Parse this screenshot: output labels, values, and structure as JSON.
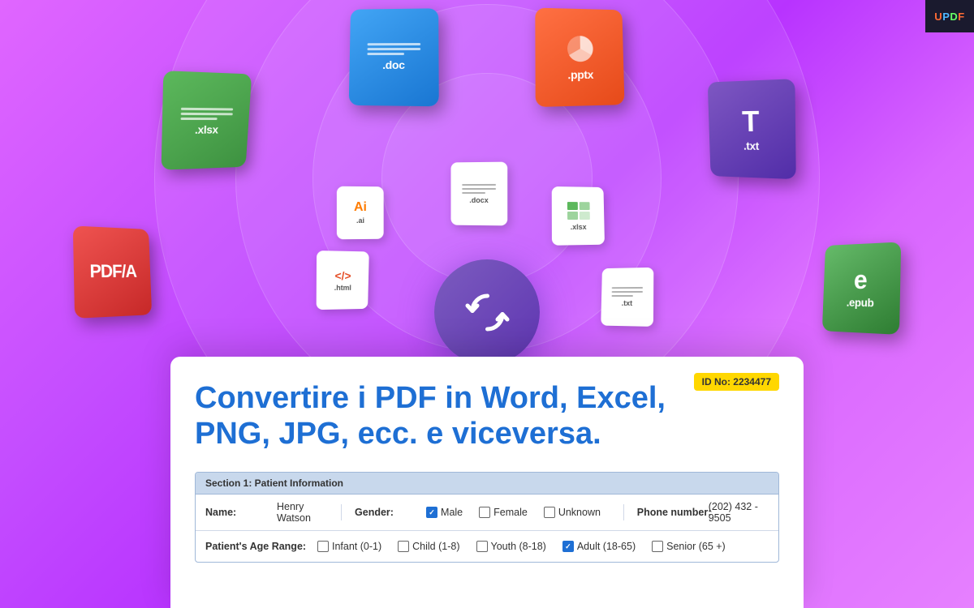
{
  "app": {
    "logo": "UPDF",
    "logo_u": "U",
    "logo_p": "P",
    "logo_d": "D",
    "logo_f": "F"
  },
  "file_icons": {
    "large": [
      {
        "name": "xlsx",
        "label": ".xlsx",
        "color_start": "#5cb85c",
        "color_end": "#3d9140"
      },
      {
        "name": "doc",
        "label": ".doc",
        "color_start": "#42a5f5",
        "color_end": "#1976d2"
      },
      {
        "name": "pptx",
        "label": ".pptx",
        "color_start": "#ff7043",
        "color_end": "#e64a19"
      },
      {
        "name": "txt",
        "label": ".txt",
        "color_start": "#7e57c2",
        "color_end": "#512da8"
      },
      {
        "name": "pdfa",
        "label": "PDF/A",
        "color_start": "#ef5350",
        "color_end": "#c62828"
      },
      {
        "name": "epub",
        "label": ".epub",
        "color_start": "#66bb6a",
        "color_end": "#2e7d32"
      }
    ],
    "small": [
      {
        "name": "docx",
        "label": ".docx"
      },
      {
        "name": "xlsx",
        "label": ".xlsx"
      },
      {
        "name": "html",
        "label": ".html"
      },
      {
        "name": "txt",
        "label": ".txt"
      },
      {
        "name": "ai",
        "label": ".ai"
      }
    ]
  },
  "document": {
    "id_label": "ID No: 2234477",
    "title": "Convertire i PDF in Word, Excel, PNG, JPG, ecc. e viceversa.",
    "section1_header": "Section 1: Patient Information",
    "row1": {
      "name_label": "Name:",
      "name_value": "Henry Watson",
      "gender_label": "Gender:",
      "male_label": "Male",
      "female_label": "Female",
      "unknown_label": "Unknown",
      "male_checked": true,
      "female_checked": false,
      "unknown_checked": false,
      "phone_label": "Phone number:",
      "phone_value": "(202) 432 - 9505"
    },
    "row2": {
      "age_label": "Patient's Age Range:",
      "infant_label": "Infant (0-1)",
      "child_label": "Child (1-8)",
      "youth_label": "Youth (8-18)",
      "adult_label": "Adult (18-65)",
      "senior_label": "Senior (65 +)",
      "infant_checked": false,
      "child_checked": false,
      "youth_checked": false,
      "adult_checked": true,
      "senior_checked": false
    }
  }
}
